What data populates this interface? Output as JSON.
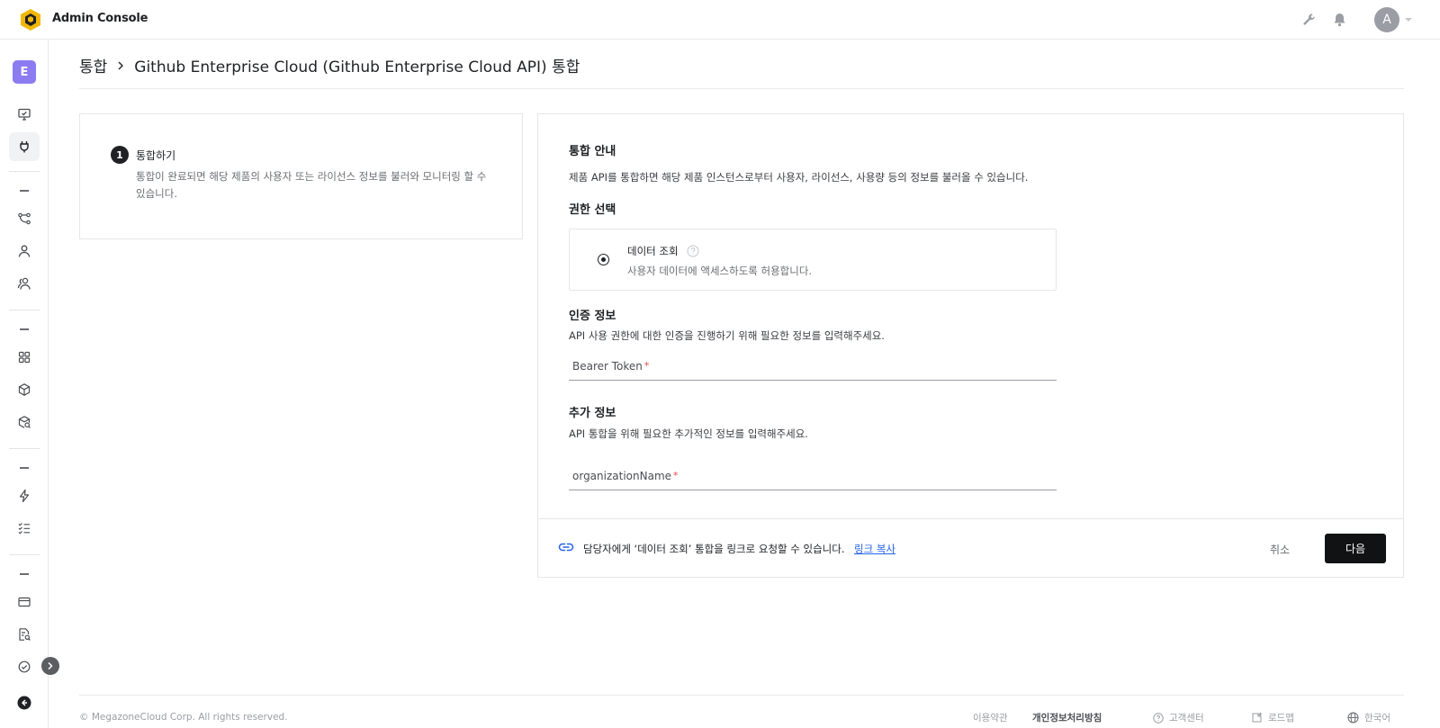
{
  "app": {
    "title": "Admin Console"
  },
  "user": {
    "avatar_initial": "A"
  },
  "workspace": {
    "initial": "E"
  },
  "breadcrumb": {
    "parent": "통합",
    "current": "Github Enterprise Cloud (Github Enterprise Cloud API) 통합"
  },
  "steps": [
    {
      "number": "1",
      "title": "통합하기",
      "description": "통합이 완료되면 해당 제품의 사용자 또는 라이선스 정보를 불러와 모니터링 할 수 있습니다."
    }
  ],
  "guide": {
    "title": "통합 안내",
    "description": "제품 API를 통합하면 해당 제품 인스턴스로부터 사용자, 라이선스, 사용량 등의 정보를 불러올 수 있습니다."
  },
  "permission": {
    "title": "권한 선택",
    "option_label": "데이터 조회",
    "option_desc": "사용자 데이터에 액세스하도록 허용합니다."
  },
  "auth": {
    "title": "인증 정보",
    "description": "API 사용 권한에 대한 인증을 진행하기 위해 필요한 정보를 입력해주세요.",
    "field_label": "Bearer Token",
    "required_mark": "*"
  },
  "extra": {
    "title": "추가 정보",
    "description": "API 통합을 위해 필요한 추가적인 정보를 입력해주세요.",
    "field_label": "organizationName",
    "required_mark": "*"
  },
  "action_bar": {
    "message": "담당자에게 ‘데이터 조회’ 통합을 링크로 요청할 수 있습니다.",
    "copy_link": "링크 복사",
    "cancel": "취소",
    "next": "다음"
  },
  "footer": {
    "copyright": "© MegazoneCloud Corp. All rights reserved.",
    "terms": "이용약관",
    "privacy": "개인정보처리방침",
    "support": "고객센터",
    "roadmap": "로드맵",
    "language": "한국어"
  },
  "colors": {
    "accent_purple": "#8b7cf2",
    "primary_button": "#111214",
    "link_blue": "#2563eb",
    "required_red": "#e5484d"
  },
  "icons": [
    "logo-icon",
    "wrench-icon",
    "bell-icon",
    "chevron-down-icon",
    "monitor-icon",
    "plug-icon",
    "flow-icon",
    "user-icon",
    "users-icon",
    "grid-icon",
    "box-icon",
    "box-search-icon",
    "lightning-icon",
    "checklist-icon",
    "card-icon",
    "document-icon",
    "shield-check-icon",
    "chevron-right-icon",
    "logout-icon",
    "help-icon",
    "link-icon",
    "globe-icon"
  ]
}
